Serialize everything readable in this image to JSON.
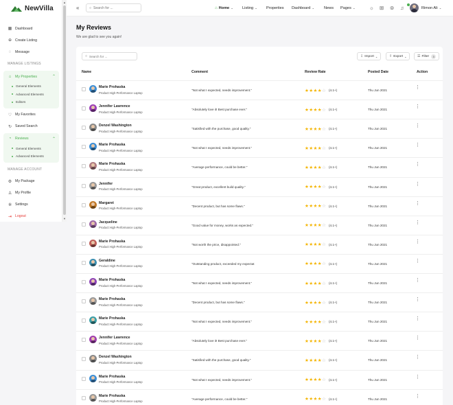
{
  "brand": {
    "name": "NewVilla"
  },
  "colors": {
    "accent": "#4caf50",
    "danger": "#e53935",
    "star": "#f4b400"
  },
  "sidebar": {
    "dashboard": "Dashboard",
    "create_listing": "Create Listing",
    "message": "Message",
    "manage_listings": "MANAGE LISTINGS",
    "my_properties": "My Properties",
    "my_properties_sub": [
      "General Elements",
      "Advanced Elements",
      "Editors"
    ],
    "my_favorites": "My Favorites",
    "saved_search": "Saved Search",
    "reviews": "Reviews",
    "reviews_sub": [
      "General Elements",
      "Advanced Elements"
    ],
    "manage_account": "MANAGE ACCOUNT",
    "my_package": "My Package",
    "my_profile": "My Profile",
    "settings": "Settings",
    "logout": "Logout"
  },
  "header": {
    "search_placeholder": "Search for ...",
    "nav": {
      "home": "Home",
      "listing": "Listing",
      "properties": "Properties",
      "dashboard": "Dashboard",
      "news": "News",
      "pages": "Pages"
    },
    "user_name": "Rimon Ali"
  },
  "page": {
    "title": "My Reviews",
    "subtitle": "We are glad to see you again!"
  },
  "table": {
    "search_placeholder": "Search for ...",
    "import": "Import",
    "export": "Export",
    "filter": "Filter",
    "filter_count": "3",
    "columns": {
      "name": "Name",
      "comment": "Comment",
      "rate": "Review Rate",
      "date": "Posted Date",
      "action": "Action"
    },
    "rows": [
      {
        "name": "Marie Prohaska",
        "product": "Product:High-Performance Laptop",
        "comment": "\"Not what I expected, needs improvement.\"",
        "stars": 4,
        "rate": "(4.1+)",
        "date": "Thu Jun 2021",
        "avatar": "#3d8fd6"
      },
      {
        "name": "Jennifer Lawrence",
        "product": "Product:High-Performance Laptop",
        "comment": "\"Absolutely love it! Best purchase ever.\"",
        "stars": 4,
        "rate": "(4.1+)",
        "date": "Thu Jun 2021",
        "avatar": "#9b3fb8"
      },
      {
        "name": "Denzel Washington",
        "product": "Product:High-Performance Laptop",
        "comment": "\"Satisfied with the purchase, good quality.\"",
        "stars": 4,
        "rate": "(4.1+)",
        "date": "Thu Jun 2021",
        "avatar": "#8a8a8a"
      },
      {
        "name": "Marie Prohaska",
        "product": "Product:High-Performance Laptop",
        "comment": "\"Not what I expected, needs improvement.\"",
        "stars": 4,
        "rate": "(4.1+)",
        "date": "Thu Jun 2021",
        "avatar": "#3d8fd6"
      },
      {
        "name": "Marie Prohaska",
        "product": "Product:High-Performance Laptop",
        "comment": "\"Average performance, could be better.\"",
        "stars": 4,
        "rate": "(4.1+)",
        "date": "Thu Jun 2021",
        "avatar": "#b07c82"
      },
      {
        "name": "Jennifer",
        "product": "Product:High-Performance Laptop",
        "comment": "\"Great product, excellent build quality.\"",
        "stars": 4,
        "rate": "(4.1+)",
        "date": "Thu Jun 2021",
        "avatar": "#9a9a9a"
      },
      {
        "name": "Margaret",
        "product": "Product:High-Performance Laptop",
        "comment": "\"Decent product, but has some flaws.\"",
        "stars": 4,
        "rate": "(4.1+)",
        "date": "Thu Jun 2021",
        "avatar": "#c27b2a"
      },
      {
        "name": "Jacqueline",
        "product": "Product:High-Performance Laptop",
        "comment": "\"Good value for money, works as expected.\"",
        "stars": 4,
        "rate": "(4.1+)",
        "date": "Thu Jun 2021",
        "avatar": "#9f6aa8"
      },
      {
        "name": "Marie Prohaska",
        "product": "Product:High-Performance Laptop",
        "comment": "\"Not worth the price, disappointed.\"",
        "stars": 4,
        "rate": "(4.1+)",
        "date": "Thu Jun 2021",
        "avatar": "#c0605a"
      },
      {
        "name": "Geraldine",
        "product": "Product:High-Performance Laptop",
        "comment": "\"Outstanding product, exceeded my expectat",
        "stars": 4,
        "rate": "(4.1+)",
        "date": "Thu Jun 2021",
        "avatar": "#3c8fb0"
      },
      {
        "name": "Marie Prohaska",
        "product": "Product:High-Performance Laptop",
        "comment": "\"Not what I expected, needs improvement.\"",
        "stars": 4,
        "rate": "(4.1+)",
        "date": "Thu Jun 2021",
        "avatar": "#8e45b8"
      },
      {
        "name": "Marie Prohaska",
        "product": "Product:High-Performance Laptop",
        "comment": "\"Decent product, but has some flaws.\"",
        "stars": 4,
        "rate": "(4.1+)",
        "date": "Thu Jun 2021",
        "avatar": "#9a9a9a"
      },
      {
        "name": "Marie Prohaska",
        "product": "Product:High-Performance Laptop",
        "comment": "\"Not what I expected, needs improvement.\"",
        "stars": 4,
        "rate": "(4.1+)",
        "date": "Thu Jun 2021",
        "avatar": "#3a9fa8"
      },
      {
        "name": "Jennifer Lawrence",
        "product": "Product:High-Performance Laptop",
        "comment": "\"Absolutely love it! Best purchase ever.\"",
        "stars": 4,
        "rate": "(4.1+)",
        "date": "Thu Jun 2021",
        "avatar": "#a03fb0"
      },
      {
        "name": "Denzel Washington",
        "product": "Product:High-Performance Laptop",
        "comment": "\"Satisfied with the purchase, good quality.\"",
        "stars": 4,
        "rate": "(4.1+)",
        "date": "Thu Jun 2021",
        "avatar": "#8a8a8a"
      },
      {
        "name": "Marie Prohaska",
        "product": "Product:High-Performance Laptop",
        "comment": "\"Not what I expected, needs improvement.\"",
        "stars": 4,
        "rate": "(4.1+)",
        "date": "Thu Jun 2021",
        "avatar": "#3d8fd6"
      },
      {
        "name": "Marie Prohaska",
        "product": "Product:High-Performance Laptop",
        "comment": "\"Average performance, could be better.\"",
        "stars": 4,
        "rate": "(4.1+)",
        "date": "Thu Jun 2021",
        "avatar": "#9a9a9a"
      }
    ]
  }
}
